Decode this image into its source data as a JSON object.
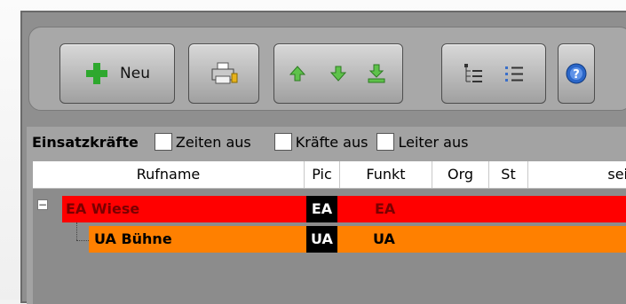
{
  "toolbar": {
    "new_label": "Neu"
  },
  "options": {
    "title": "Einsatzkräfte",
    "checkboxes": [
      {
        "label": "Zeiten aus",
        "checked": false
      },
      {
        "label": "Kräfte aus",
        "checked": false
      },
      {
        "label": "Leiter aus",
        "checked": false
      }
    ]
  },
  "table": {
    "columns": [
      "Rufname",
      "Pic",
      "Funkt",
      "Org",
      "St",
      "sei"
    ],
    "rows": [
      {
        "name": "EA Wiese",
        "pic": "EA",
        "funkt": "EA",
        "color": "#ff0000",
        "text_color": "#7a0000"
      },
      {
        "name": "UA Bühne",
        "pic": "UA",
        "funkt": "UA",
        "color": "#ff8000",
        "text_color": "#000000"
      }
    ]
  },
  "colors": {
    "plus_green": "#2ea82e",
    "help_blue": "#2a66c8"
  }
}
